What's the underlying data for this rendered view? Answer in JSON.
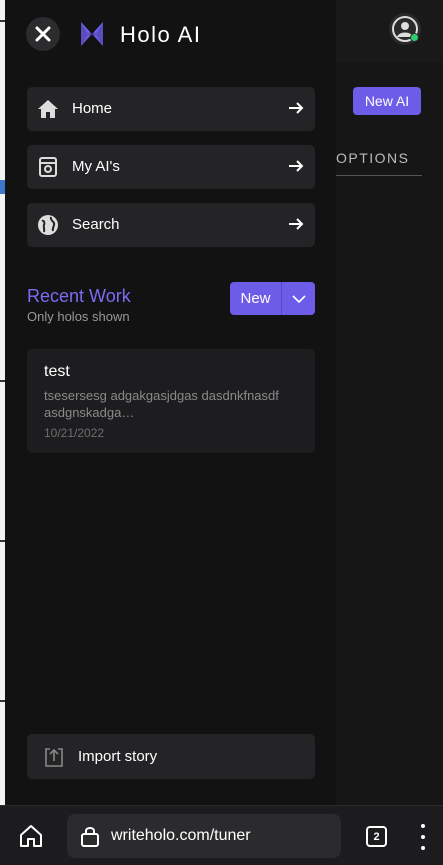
{
  "drawer": {
    "brand": "Holo AI",
    "nav": [
      {
        "label": "Home"
      },
      {
        "label": "My AI's"
      },
      {
        "label": "Search"
      }
    ],
    "recent": {
      "title": "Recent Work",
      "subtitle": "Only holos shown",
      "new_label": "New",
      "items": [
        {
          "title": "test",
          "description": "tsesersesg adgakgasjdgas dasdnkfnasdf asdgnskadga…",
          "date": "10/21/2022"
        }
      ]
    },
    "import_label": "Import story"
  },
  "background_page": {
    "new_ai_label": "New AI",
    "options_label": "OPTIONS"
  },
  "browser": {
    "url": "writeholo.com/tuner",
    "tab_count": "2"
  },
  "colors": {
    "accent": "#6c5ce7",
    "accent_text": "#7b6cf6",
    "online": "#2ecc71"
  }
}
